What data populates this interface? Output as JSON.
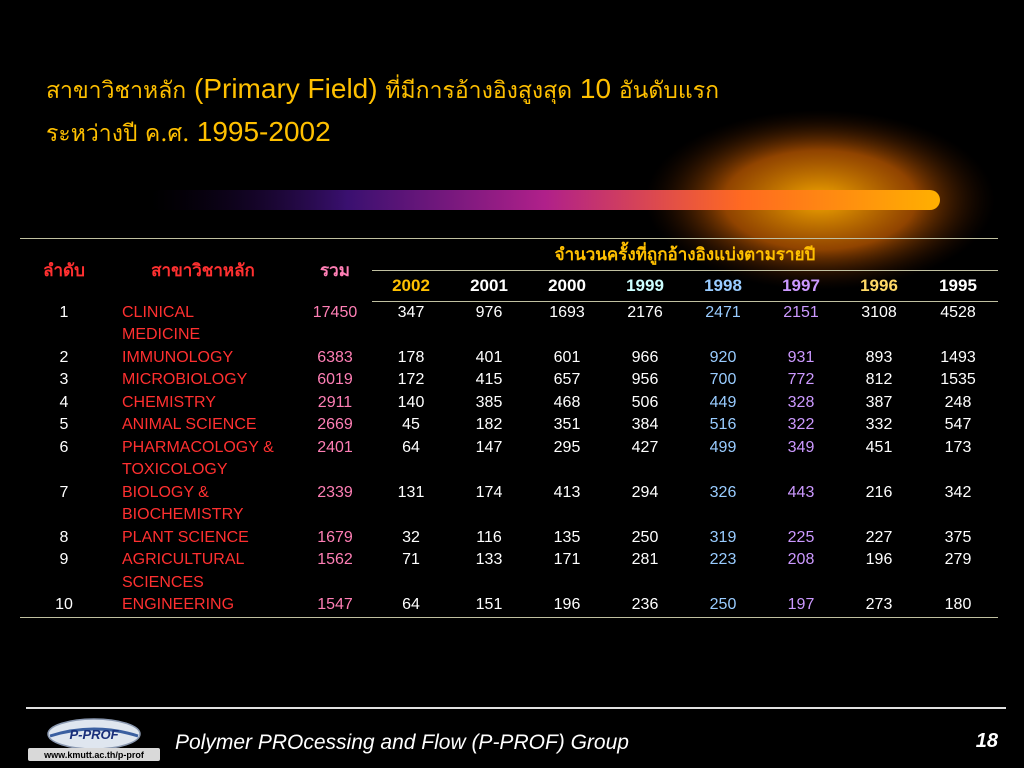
{
  "title": {
    "line1_thai_a": "สาขาวิชาหลัก",
    "line1_en": " (Primary Field) ",
    "line1_thai_b": "ที่มีการอ้างอิงสูงสุด",
    "line1_num": " 10 ",
    "line1_thai_c": "อันดับแรก",
    "line2_thai": "ระหว่างปี ค.ศ. ",
    "line2_years": "1995-2002"
  },
  "table": {
    "headers": {
      "rank": "ลำดับ",
      "field": "สาขาวิชาหลัก",
      "total": "รวม",
      "group": "จำนวนครั้งที่ถูกอ้างอิงแบ่งตามรายปี",
      "years": [
        "2002",
        "2001",
        "2000",
        "1999",
        "1998",
        "1997",
        "1996",
        "1995"
      ]
    },
    "rows": [
      {
        "rank": "1",
        "field_l1": "CLINICAL",
        "field_l2": "MEDICINE",
        "total": "17450",
        "y": [
          "347",
          "976",
          "1693",
          "2176",
          "2471",
          "2151",
          "3108",
          "4528"
        ]
      },
      {
        "rank": "2",
        "field_l1": "IMMUNOLOGY",
        "field_l2": "",
        "total": "6383",
        "y": [
          "178",
          "401",
          "601",
          "966",
          "920",
          "931",
          "893",
          "1493"
        ]
      },
      {
        "rank": "3",
        "field_l1": "MICROBIOLOGY",
        "field_l2": "",
        "total": "6019",
        "y": [
          "172",
          "415",
          "657",
          "956",
          "700",
          "772",
          "812",
          "1535"
        ]
      },
      {
        "rank": "4",
        "field_l1": "CHEMISTRY",
        "field_l2": "",
        "total": "2911",
        "y": [
          "140",
          "385",
          "468",
          "506",
          "449",
          "328",
          "387",
          "248"
        ]
      },
      {
        "rank": "5",
        "field_l1": "ANIMAL SCIENCE",
        "field_l2": "",
        "total": "2669",
        "y": [
          "45",
          "182",
          "351",
          "384",
          "516",
          "322",
          "332",
          "547"
        ]
      },
      {
        "rank": "6",
        "field_l1": "PHARMACOLOGY &",
        "field_l2": "TOXICOLOGY",
        "total": "2401",
        "y": [
          "64",
          "147",
          "295",
          "427",
          "499",
          "349",
          "451",
          "173"
        ]
      },
      {
        "rank": "7",
        "field_l1": "BIOLOGY &",
        "field_l2": "BIOCHEMISTRY",
        "total": "2339",
        "y": [
          "131",
          "174",
          "413",
          "294",
          "326",
          "443",
          "216",
          "342"
        ]
      },
      {
        "rank": "8",
        "field_l1": "PLANT SCIENCE",
        "field_l2": "",
        "total": "1679",
        "y": [
          "32",
          "116",
          "135",
          "250",
          "319",
          "225",
          "227",
          "375"
        ]
      },
      {
        "rank": "9",
        "field_l1": "AGRICULTURAL",
        "field_l2": "SCIENCES",
        "total": "1562",
        "y": [
          "71",
          "133",
          "171",
          "281",
          "223",
          "208",
          "196",
          "279"
        ]
      },
      {
        "rank": "10",
        "field_l1": "ENGINEERING",
        "field_l2": "",
        "total": "1547",
        "y": [
          "64",
          "151",
          "196",
          "236",
          "250",
          "197",
          "273",
          "180"
        ]
      }
    ]
  },
  "footer": {
    "logo_text": "P-PROF",
    "logo_url": "www.kmutt.ac.th/p-prof",
    "group": "Polymer PROcessing and Flow (P-PROF) Group",
    "page": "18"
  },
  "colors": {
    "title": "#ffc000",
    "field_names": "#ff3030",
    "total": "#ff7fb5",
    "year_2002": "#ffc000",
    "year_1999": "#ccffff",
    "year_1998": "#99ccff",
    "year_1997": "#cc99ff",
    "year_1996": "#ffd966"
  }
}
